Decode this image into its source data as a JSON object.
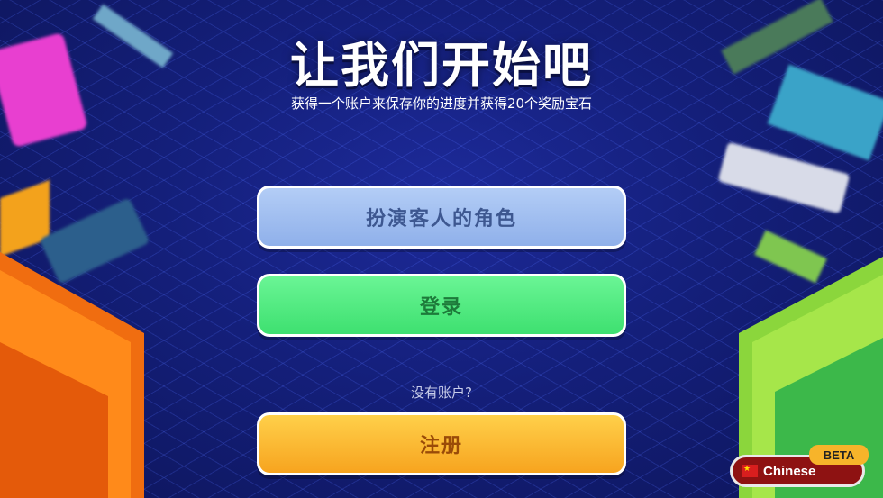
{
  "header": {
    "title": "让我们开始吧",
    "subtitle": "获得一个账户来保存你的进度并获得20个奖励宝石"
  },
  "buttons": {
    "guest_label": "扮演客人的角色",
    "login_label": "登录",
    "register_label": "注册"
  },
  "no_account_text": "没有账户?",
  "language": {
    "name": "Chinese",
    "badge": "BETA"
  },
  "colors": {
    "background": "#141f7a",
    "guest_button": "#a4c1f2",
    "login_button": "#4deb80",
    "register_button": "#fbbb35",
    "language_pill": "#8e1212"
  }
}
